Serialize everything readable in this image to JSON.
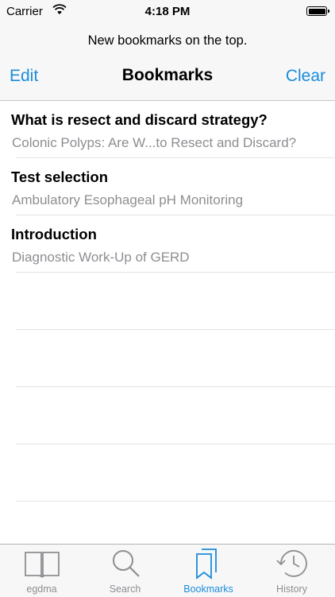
{
  "status_bar": {
    "carrier": "Carrier",
    "time": "4:18 PM"
  },
  "nav": {
    "note": "New bookmarks on the top.",
    "edit_label": "Edit",
    "title": "Bookmarks",
    "clear_label": "Clear"
  },
  "bookmarks": [
    {
      "title": "What is resect and discard strategy?",
      "subtitle": "Colonic Polyps: Are W...to Resect and Discard?"
    },
    {
      "title": "Test selection",
      "subtitle": "Ambulatory Esophageal pH Monitoring"
    },
    {
      "title": "Introduction",
      "subtitle": "Diagnostic Work-Up of GERD"
    }
  ],
  "tabs": [
    {
      "label": "egdma",
      "icon": "book-icon"
    },
    {
      "label": "Search",
      "icon": "search-icon"
    },
    {
      "label": "Bookmarks",
      "icon": "bookmarks-icon"
    },
    {
      "label": "History",
      "icon": "history-icon"
    }
  ],
  "colors": {
    "accent": "#1a8cdb",
    "inactive": "#8e8e93",
    "bar_bg": "#f7f7f7"
  }
}
